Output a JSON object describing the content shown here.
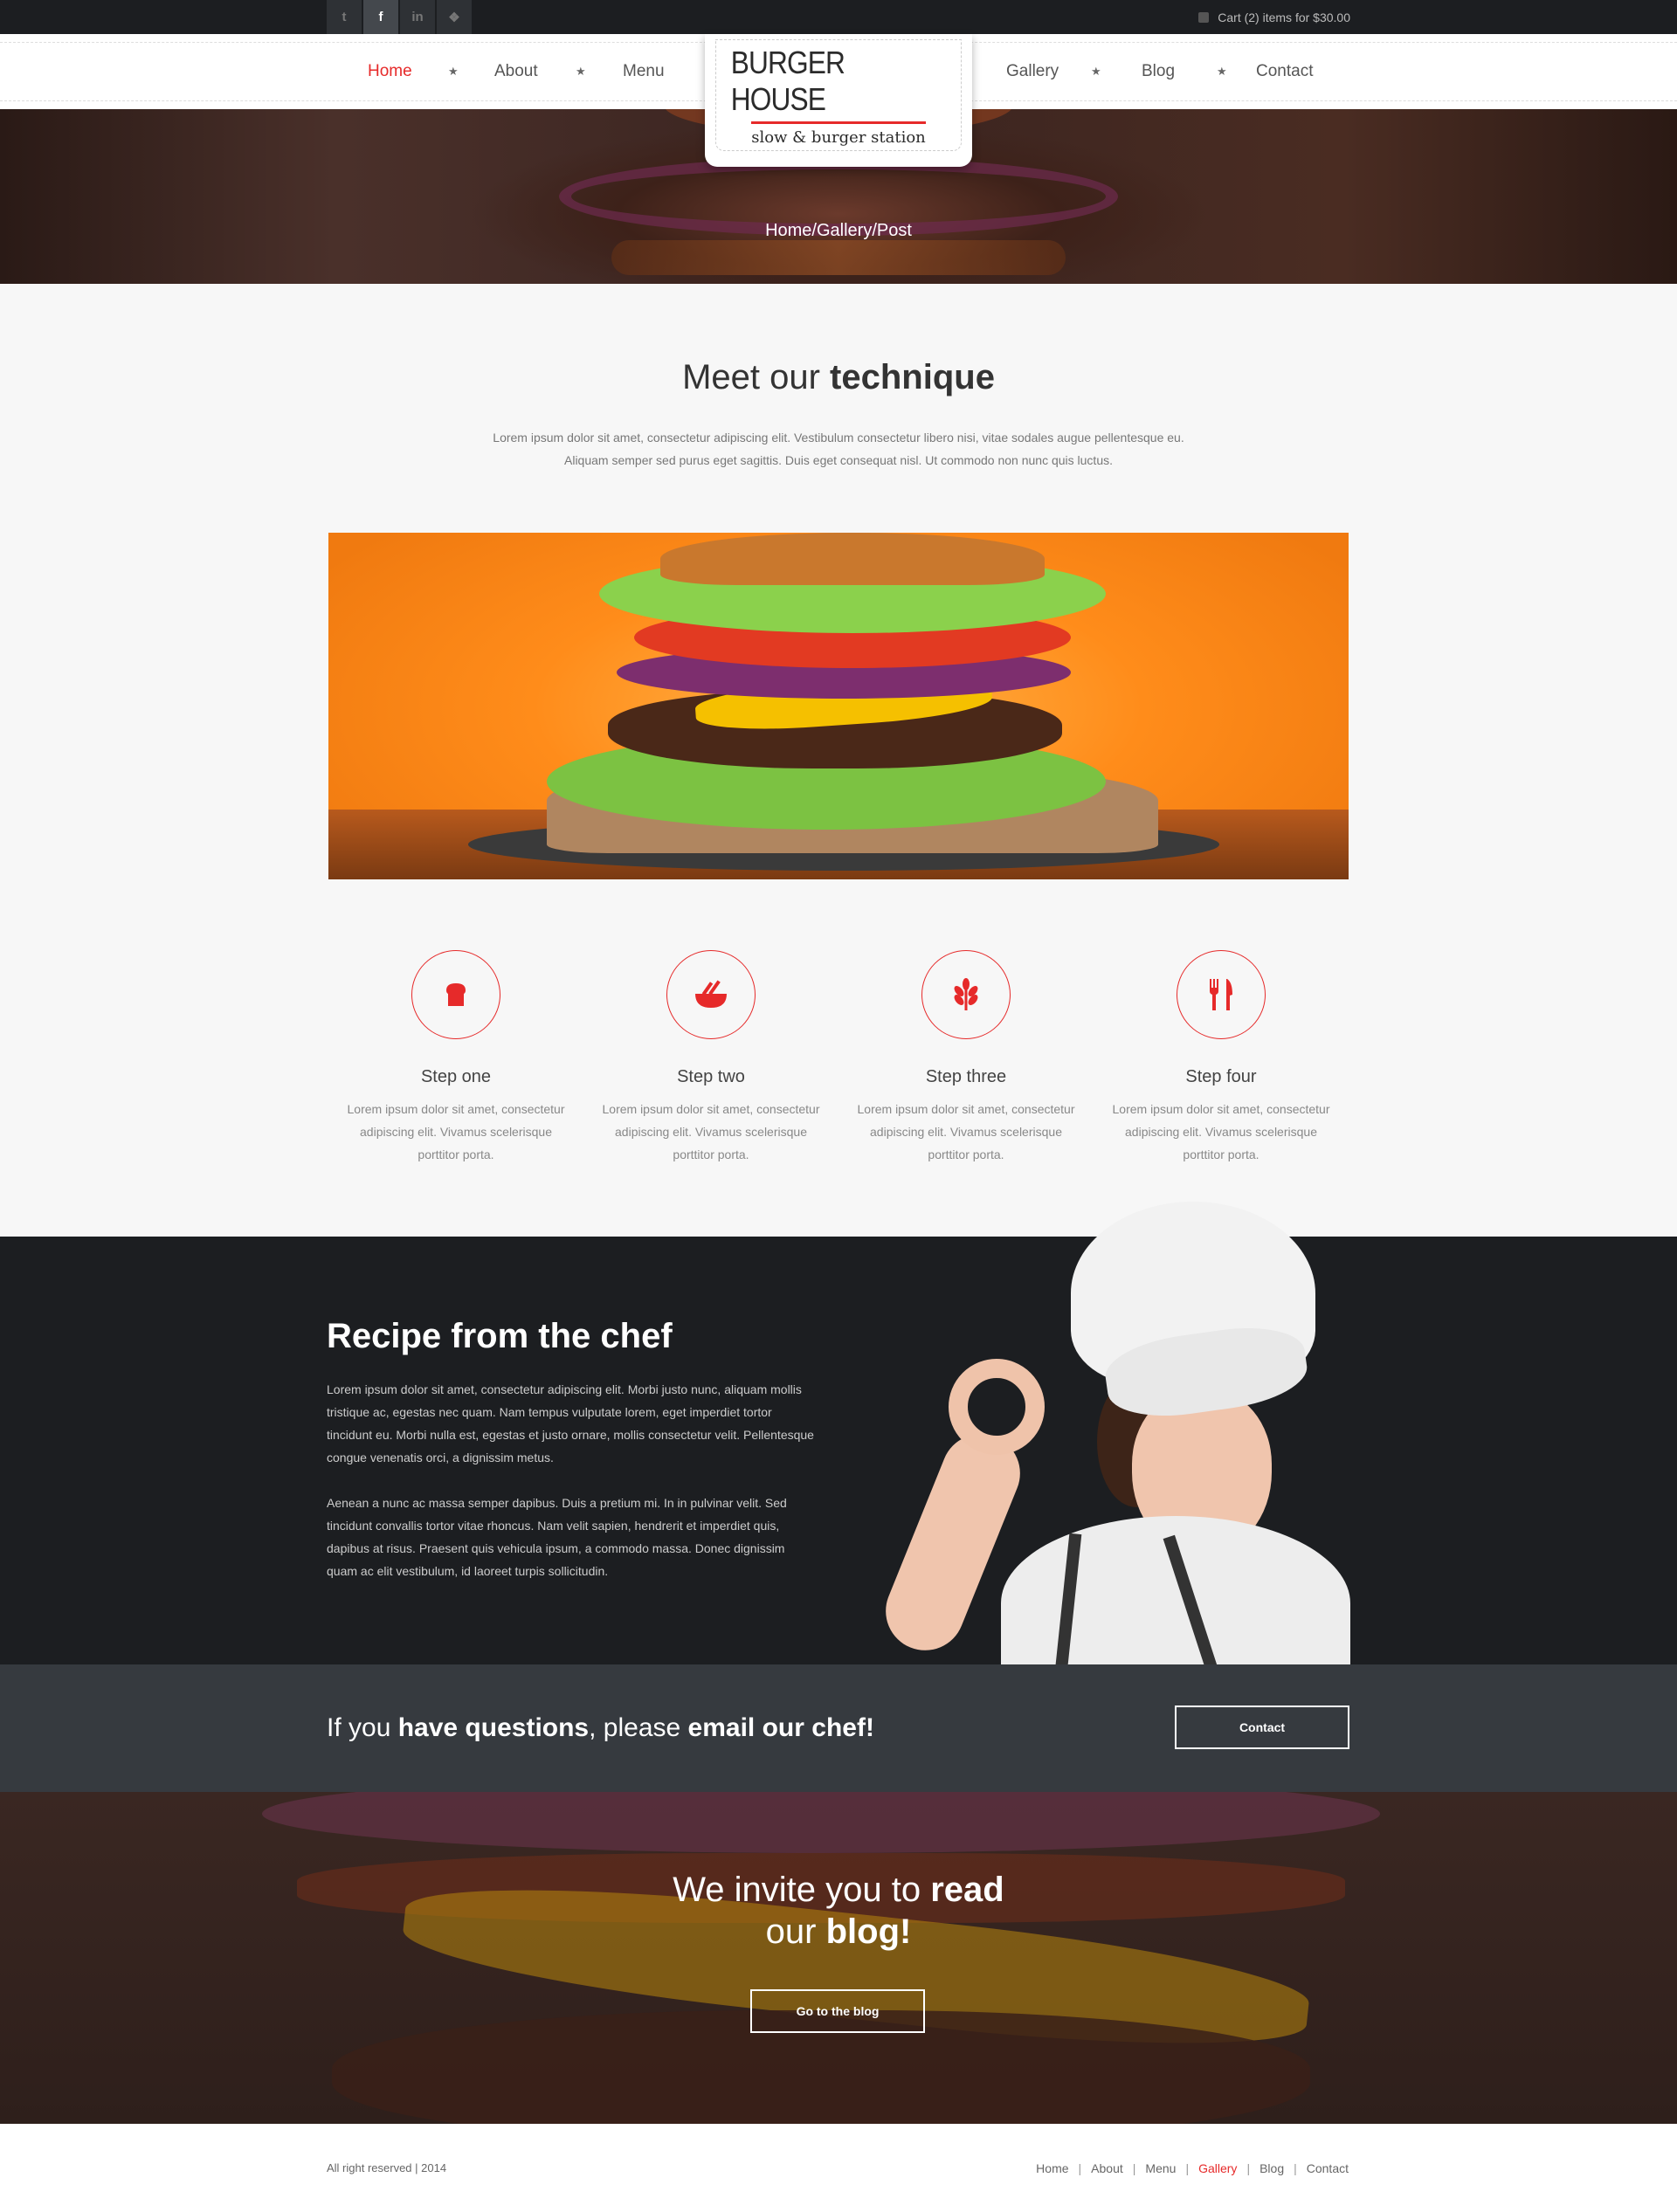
{
  "topbar": {
    "social": [
      "twitter-icon",
      "facebook-icon",
      "linkedin-icon",
      "dribbble-icon"
    ],
    "social_glyphs": [
      "t",
      "f",
      "in",
      "❖"
    ],
    "cart_text": "Cart (2) items for $30.00"
  },
  "nav": {
    "left": [
      {
        "label": "Home",
        "active": true
      },
      {
        "label": "About",
        "active": false
      },
      {
        "label": "Menu",
        "active": false
      }
    ],
    "right": [
      {
        "label": "Gallery",
        "active": false
      },
      {
        "label": "Blog",
        "active": false
      },
      {
        "label": "Contact",
        "active": false
      }
    ],
    "star": "★"
  },
  "logo": {
    "title": "BURGER HOUSE",
    "subtitle": "slow & burger station"
  },
  "breadcrumb": [
    "Home",
    "Gallery",
    "Post"
  ],
  "technique": {
    "title_pre": "Meet our ",
    "title_bold": "technique",
    "desc_line1": "Lorem ipsum dolor sit amet, consectetur adipiscing elit. Vestibulum consectetur libero nisi, vitae sodales augue pellentesque eu.",
    "desc_line2": "Aliquam semper sed purus eget sagittis. Duis eget consequat nisl. Ut commodo non nunc quis luctus."
  },
  "steps": [
    {
      "icon": "toast-icon",
      "title": "Step one",
      "text": "Lorem ipsum dolor sit amet, consectetur adipiscing elit. Vivamus scelerisque porttitor porta."
    },
    {
      "icon": "bowl-icon",
      "title": "Step two",
      "text": "Lorem ipsum dolor sit amet, consectetur adipiscing elit. Vivamus scelerisque porttitor porta."
    },
    {
      "icon": "wheat-icon",
      "title": "Step three",
      "text": "Lorem ipsum dolor sit amet, consectetur adipiscing elit. Vivamus scelerisque porttitor porta."
    },
    {
      "icon": "fork-knife-icon",
      "title": "Step four",
      "text": "Lorem ipsum dolor sit amet, consectetur adipiscing elit. Vivamus scelerisque porttitor porta."
    }
  ],
  "chef": {
    "title_bold1": "Recipe",
    "title_mid": " from the ",
    "title_bold2": "chef",
    "para1": "Lorem ipsum dolor sit amet, consectetur adipiscing elit. Morbi justo nunc, aliquam mollis tristique ac, egestas nec quam. Nam tempus vulputate lorem, eget imperdiet tortor tincidunt eu. Morbi nulla est, egestas et justo ornare, mollis consectetur velit. Pellentesque congue venenatis orci, a dignissim metus.",
    "para2": "Aenean a nunc ac massa semper dapibus. Duis a pretium mi. In in pulvinar velit. Sed tincidunt convallis tortor vitae rhoncus. Nam velit sapien, hendrerit et imperdiet quis, dapibus at risus. Praesent quis vehicula ipsum, a commodo massa. Donec dignissim quam ac elit vestibulum, id laoreet turpis sollicitudin."
  },
  "questions": {
    "pre": "If you ",
    "bold1": "have questions",
    "mid": ", please ",
    "bold2": "email our chef!",
    "button": "Contact"
  },
  "blog": {
    "line1_pre": "We invite you to ",
    "line1_bold": "read",
    "line2_pre": "our ",
    "line2_bold": "blog!",
    "button": "Go to the blog"
  },
  "footer": {
    "copyright": "All right reserved | 2014",
    "links": [
      {
        "label": "Home",
        "active": false
      },
      {
        "label": "About",
        "active": false
      },
      {
        "label": "Menu",
        "active": false
      },
      {
        "label": "Gallery",
        "active": true
      },
      {
        "label": "Blog",
        "active": false
      },
      {
        "label": "Contact",
        "active": false
      }
    ]
  },
  "colors": {
    "accent": "#e62a2a",
    "dark": "#1c1e21",
    "band": "#363a3f"
  }
}
